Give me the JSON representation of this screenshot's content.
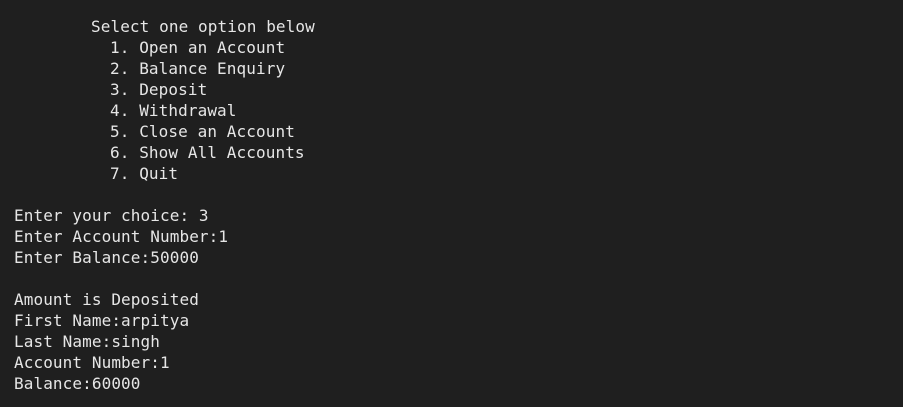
{
  "menu": {
    "heading": "Select one option below",
    "items": [
      "1. Open an Account",
      "2. Balance Enquiry",
      "3. Deposit",
      "4. Withdrawal",
      "5. Close an Account",
      "6. Show All Accounts",
      "7. Quit"
    ]
  },
  "session": {
    "choice_line": "Enter your choice: 3",
    "account_number_prompt": "Enter Account Number:1",
    "balance_prompt": "Enter Balance:50000"
  },
  "result": {
    "status": "Amount is Deposited",
    "first_name": "First Name:arpitya",
    "last_name": "Last Name:singh",
    "account_number": "Account Number:1",
    "balance": "Balance:60000"
  },
  "colors": {
    "background": "#1f1f1f",
    "text": "#e6e6e6"
  }
}
